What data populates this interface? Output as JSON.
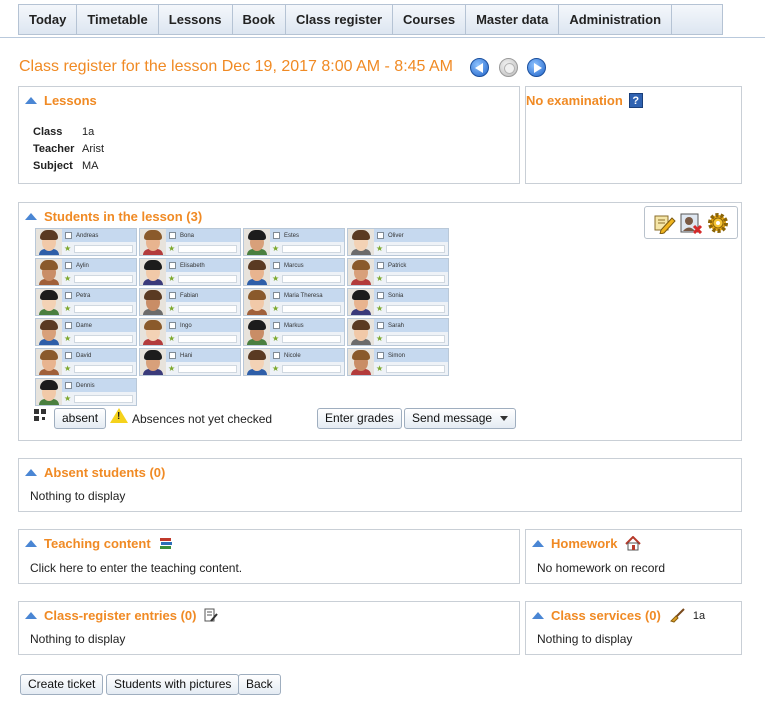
{
  "nav": {
    "tabs": [
      "Today",
      "Timetable",
      "Lessons",
      "Book",
      "Class register",
      "Courses",
      "Master data",
      "Administration"
    ]
  },
  "title": "Class register for the lesson Dec 19, 2017 8:00 AM - 8:45 AM",
  "lessons": {
    "heading": "Lessons",
    "fields": [
      {
        "key": "Class",
        "value": "1a"
      },
      {
        "key": "Teacher",
        "value": "Arist"
      },
      {
        "key": "Subject",
        "value": "MA"
      }
    ]
  },
  "examination": {
    "heading": "No examination",
    "help_icon": "?"
  },
  "students": {
    "heading": "Students in the lesson (3)",
    "list": [
      "Andreas",
      "Bona",
      "Estes",
      "Oliver",
      "Aylin",
      "Elisabeth",
      "Marcus",
      "Patrick",
      "Petra",
      "Fabian",
      "Maria Theresa",
      "Sonia",
      "Dame",
      "Ingo",
      "Markus",
      "Sarah",
      "David",
      "Hani",
      "Nicole",
      "Simon",
      "Dennis"
    ],
    "absent_button": "absent",
    "warning_text": "Absences not yet checked",
    "enter_grades_button": "Enter grades",
    "send_message_button": "Send message"
  },
  "absent_students": {
    "heading": "Absent students (0)",
    "text": "Nothing to display"
  },
  "teaching_content": {
    "heading": "Teaching content",
    "text": "Click here to enter the teaching content."
  },
  "homework": {
    "heading": "Homework",
    "text": "No homework on record"
  },
  "class_register_entries": {
    "heading": "Class-register entries (0)",
    "text": "Nothing to display"
  },
  "class_services": {
    "heading": "Class services (0)",
    "class": "1a",
    "text": "Nothing to display"
  },
  "footer": {
    "create_ticket": "Create ticket",
    "students_with_pictures": "Students with pictures",
    "back": "Back"
  },
  "colors": {
    "accent_orange": "#f08a24",
    "link_blue": "#4a86d4",
    "card_header": "#c6d9ef"
  }
}
